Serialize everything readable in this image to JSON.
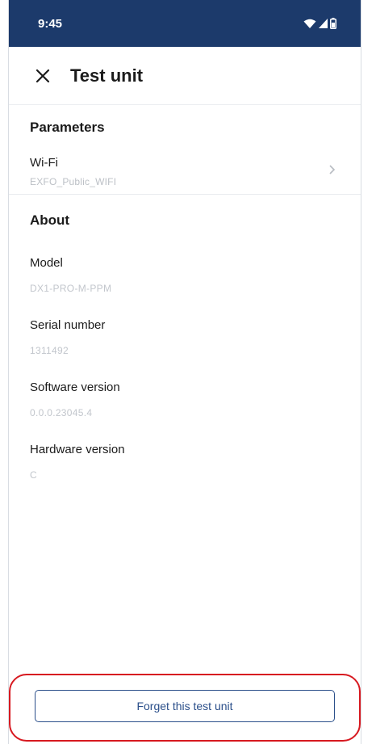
{
  "status_bar": {
    "time": "9:45",
    "icons": [
      "wifi-icon",
      "cell-signal-icon",
      "battery-icon"
    ]
  },
  "app_bar": {
    "close_icon": "close-icon",
    "title": "Test unit"
  },
  "parameters": {
    "header": "Parameters",
    "wifi": {
      "label": "Wi-Fi",
      "value": "EXFO_Public_WIFI",
      "chevron": "chevron-right-icon"
    }
  },
  "about": {
    "header": "About",
    "items": [
      {
        "label": "Model",
        "value": "DX1-PRO-M-PPM"
      },
      {
        "label": "Serial number",
        "value": "1311492"
      },
      {
        "label": "Software version",
        "value": "0.0.0.23045.4"
      },
      {
        "label": "Hardware version",
        "value": "C"
      }
    ]
  },
  "footer": {
    "forget_button": "Forget this test unit"
  },
  "colors": {
    "status_bar": "#1c3a6b",
    "accent": "#2b4f8a",
    "highlight": "#d71920"
  }
}
